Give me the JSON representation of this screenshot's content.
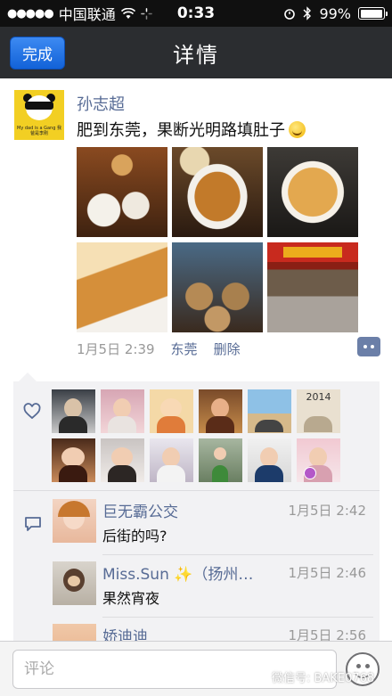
{
  "status_bar": {
    "carrier": "中国联通",
    "time": "0:33",
    "battery": "99%"
  },
  "nav": {
    "title": "详情",
    "done_label": "完成"
  },
  "post": {
    "author": "孙志超",
    "text": "肥到东莞，果断光明路填肚子",
    "avatar_caption": "My dad is a Gang 我爸是李刚",
    "date": "1月5日 2:39",
    "location": "东莞",
    "delete_label": "删除",
    "photos": [
      "har-gow-dumplings",
      "fried-spare-ribs",
      "fried-noodles",
      "fried-fish",
      "dim-sum-steamers",
      "restaurant-storefront"
    ]
  },
  "likers": {
    "count": 12,
    "names": [
      "liker-1",
      "liker-2",
      "liker-3",
      "liker-4",
      "liker-5",
      "liker-6",
      "liker-7",
      "liker-8",
      "liker-9",
      "liker-10",
      "liker-11",
      "liker-12"
    ],
    "sixth_avatar_text": "2014"
  },
  "comments": [
    {
      "name": "巨无霸公交",
      "time": "1月5日 2:42",
      "text": "后街的吗?"
    },
    {
      "name": "Miss.Sun ✨（扬州…",
      "time": "1月5日 2:46",
      "text": "果然宵夜"
    },
    {
      "name": "娇迪迪",
      "time": "1月5日 2:56",
      "text": ""
    }
  ],
  "input": {
    "placeholder": "评论"
  },
  "watermark": "微信号: BAKE0768",
  "colors": {
    "link": "#576b95",
    "nav_bg": "#2b2d30",
    "done_button": "#1f6fe0",
    "panel_bg": "#f2f2f4"
  }
}
